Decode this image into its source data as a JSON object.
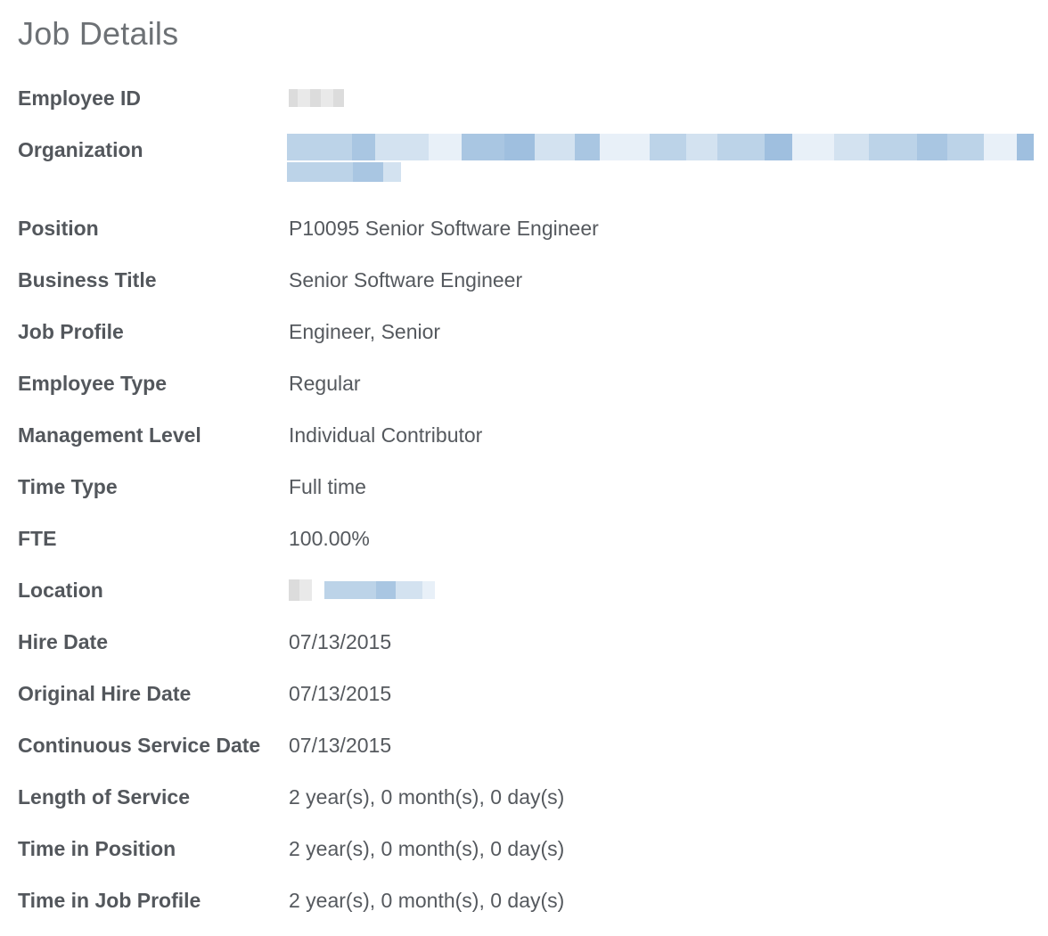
{
  "page": {
    "title": "Job Details"
  },
  "fields": [
    {
      "label": "Employee ID",
      "value": ""
    },
    {
      "label": "Organization",
      "value": ""
    },
    {
      "label": "Position",
      "value": "P10095 Senior Software Engineer"
    },
    {
      "label": "Business Title",
      "value": "Senior Software Engineer"
    },
    {
      "label": "Job Profile",
      "value": "Engineer, Senior"
    },
    {
      "label": "Employee Type",
      "value": "Regular"
    },
    {
      "label": "Management Level",
      "value": "Individual Contributor"
    },
    {
      "label": "Time Type",
      "value": "Full time"
    },
    {
      "label": "FTE",
      "value": "100.00%"
    },
    {
      "label": "Location",
      "value": ""
    },
    {
      "label": "Hire Date",
      "value": "07/13/2015"
    },
    {
      "label": "Original Hire Date",
      "value": "07/13/2015"
    },
    {
      "label": "Continuous Service Date",
      "value": "07/13/2015"
    },
    {
      "label": "Length of Service",
      "value": "2 year(s), 0 month(s), 0 day(s)"
    },
    {
      "label": "Time in Position",
      "value": "2 year(s), 0 month(s), 0 day(s)"
    },
    {
      "label": "Time in Job Profile",
      "value": "2 year(s), 0 month(s), 0 day(s)"
    }
  ],
  "colors": {
    "label_text": "#53575c",
    "value_text": "#55595e",
    "title_text": "#6d7175",
    "redacted_link": "#bcd3e8",
    "redacted_plain": "#dcdcdc"
  }
}
